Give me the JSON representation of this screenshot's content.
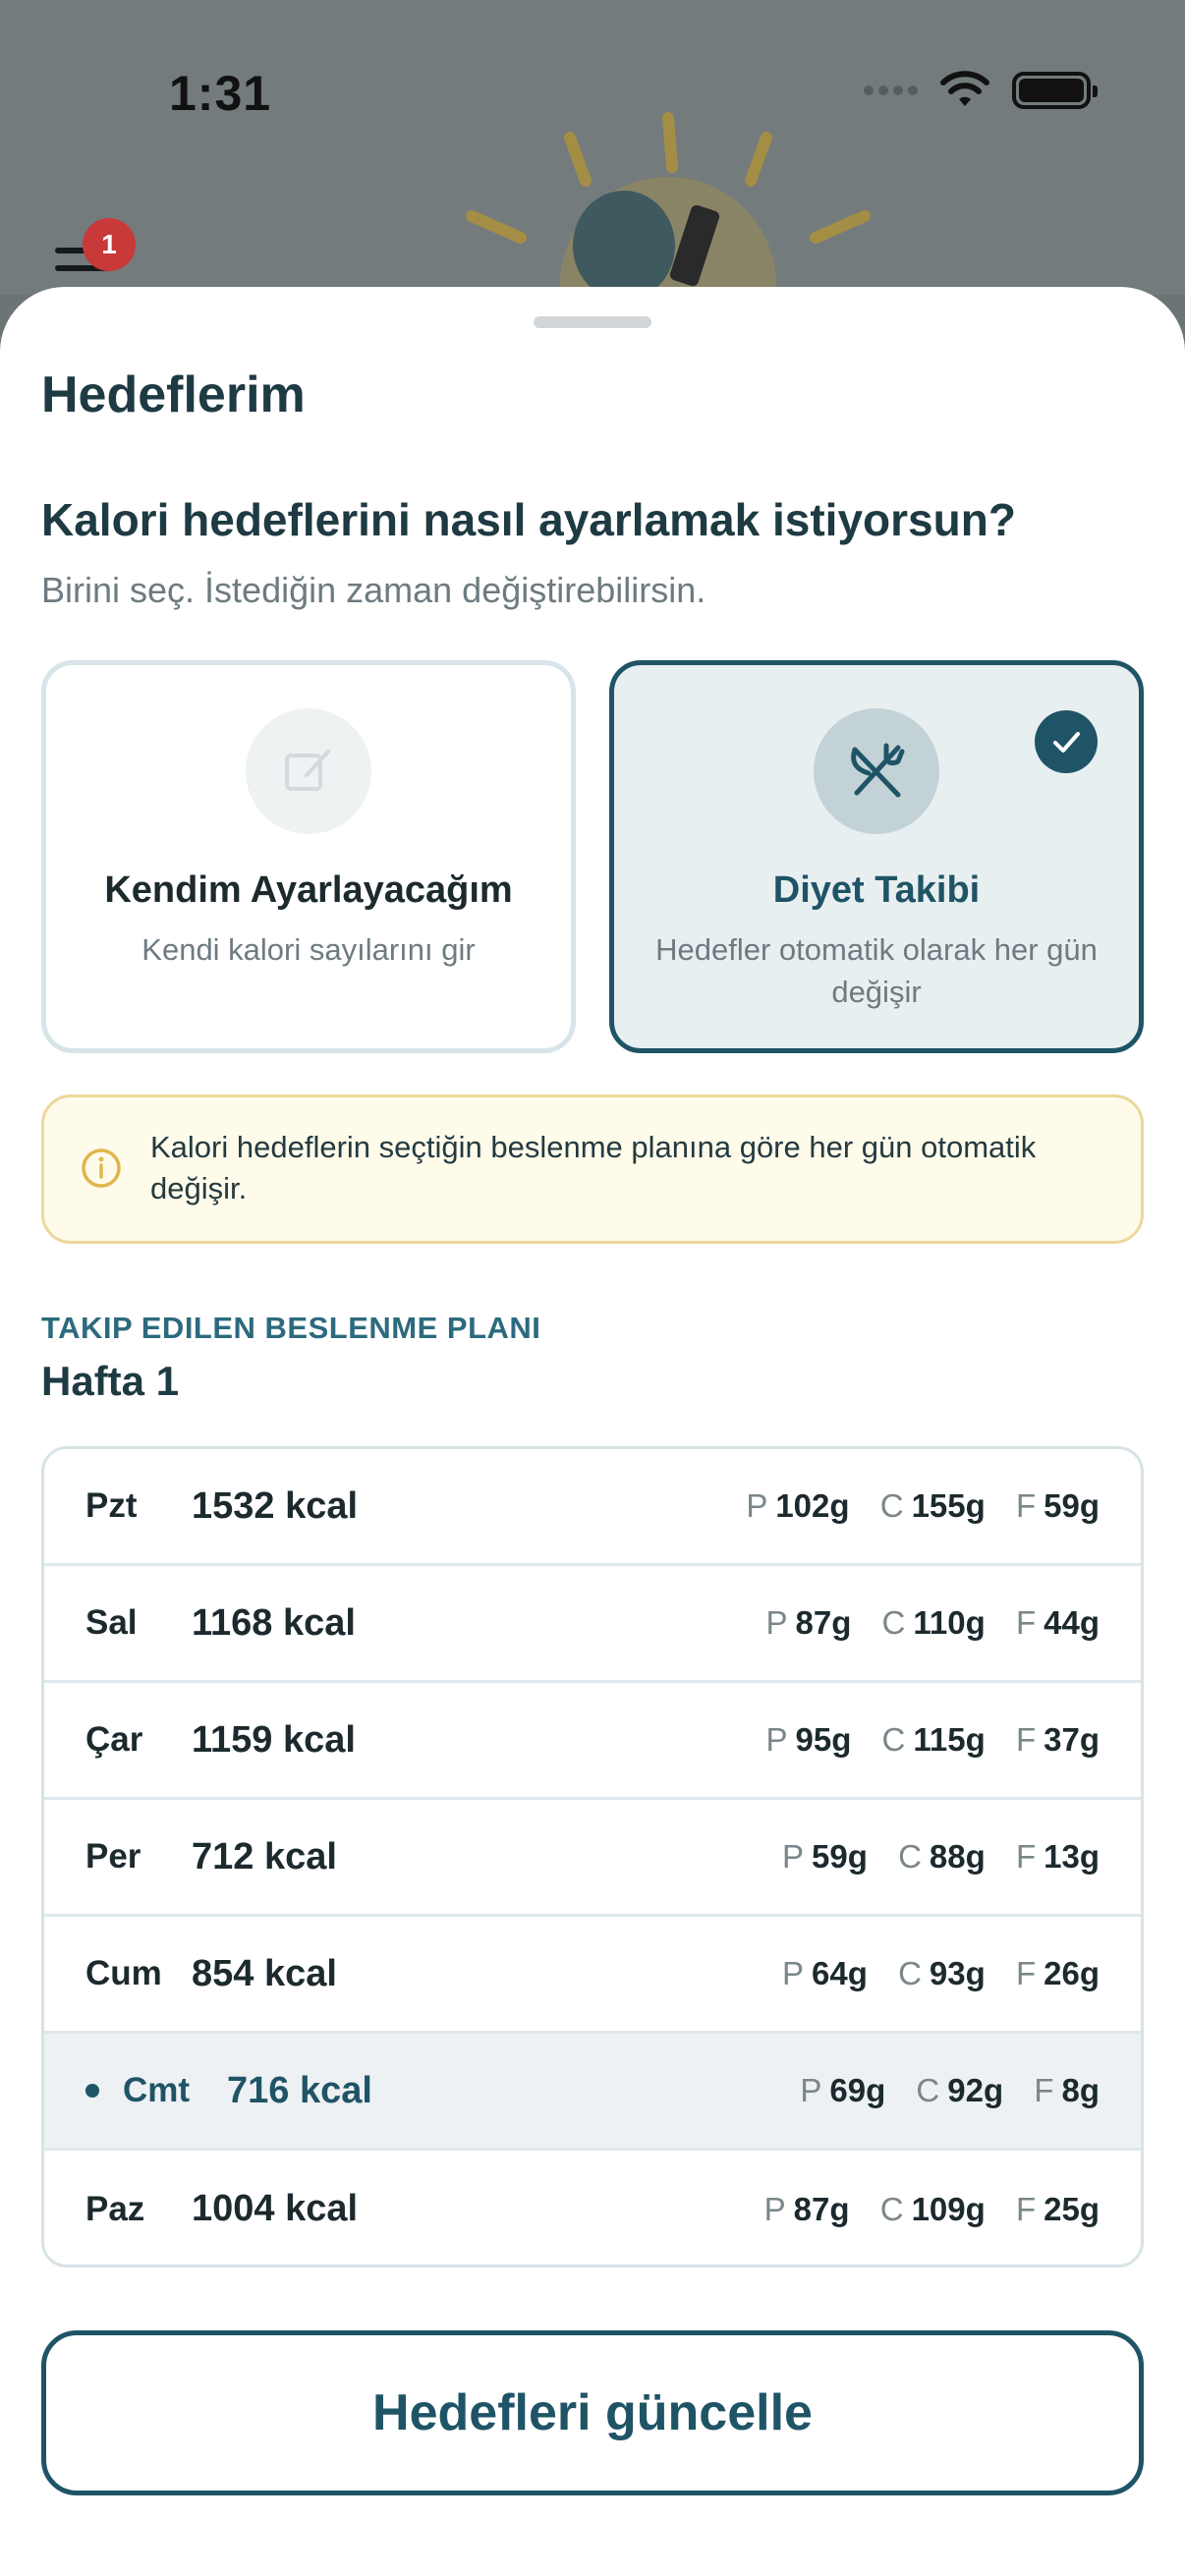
{
  "status_bar": {
    "time": "1:31"
  },
  "background": {
    "notification_count": "1"
  },
  "sheet": {
    "title": "Hedeflerim",
    "question": "Kalori hedeflerini nasıl ayarlamak istiyorsun?",
    "subtitle": "Birini seç. İstediğin zaman değiştirebilirsin.",
    "options": [
      {
        "title": "Kendim Ayarlayacağım",
        "description": "Kendi kalori sayılarını gir",
        "icon": "edit-icon",
        "selected": false
      },
      {
        "title": "Diyet Takibi",
        "description": "Hedefler otomatik olarak her gün değişir",
        "icon": "fork-knife-icon",
        "selected": true
      }
    ],
    "info": "Kalori hedeflerin seçtiğin beslenme planına göre her gün otomatik değişir.",
    "plan_label": "TAKIP EDILEN BESLENME PLANI",
    "plan_name": "Hafta 1",
    "days": [
      {
        "day": "Pzt",
        "kcal": "1532 kcal",
        "p": "102g",
        "c": "155g",
        "f": "59g"
      },
      {
        "day": "Sal",
        "kcal": "1168 kcal",
        "p": "87g",
        "c": "110g",
        "f": "44g"
      },
      {
        "day": "Çar",
        "kcal": "1159 kcal",
        "p": "95g",
        "c": "115g",
        "f": "37g"
      },
      {
        "day": "Per",
        "kcal": "712 kcal",
        "p": "59g",
        "c": "88g",
        "f": "13g"
      },
      {
        "day": "Cum",
        "kcal": "854 kcal",
        "p": "64g",
        "c": "93g",
        "f": "26g"
      },
      {
        "day": "Cmt",
        "kcal": "716 kcal",
        "p": "69g",
        "c": "92g",
        "f": "8g"
      },
      {
        "day": "Paz",
        "kcal": "1004 kcal",
        "p": "87g",
        "c": "109g",
        "f": "25g"
      }
    ],
    "macro_labels": {
      "p": "P",
      "c": "C",
      "f": "F"
    },
    "update_button": "Hedefleri güncelle"
  },
  "colors": {
    "primary": "#1f5466",
    "info_bg": "#fffbea",
    "info_border": "#ecd89c",
    "badge": "#c8393a"
  }
}
